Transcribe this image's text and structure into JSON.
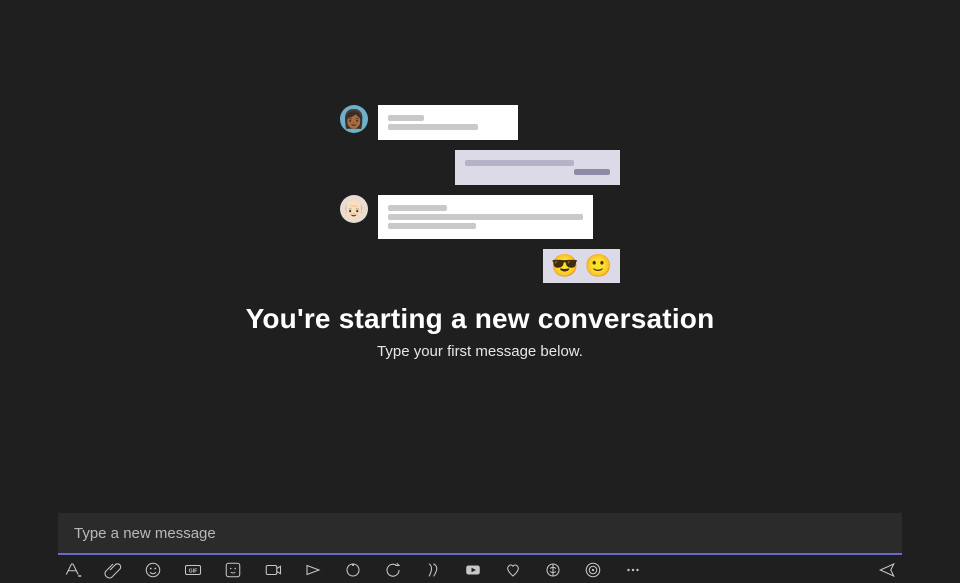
{
  "emptyState": {
    "title": "You're starting a new conversation",
    "subtitle": "Type your first message below.",
    "emoji1": "😎",
    "emoji2": "🙂"
  },
  "compose": {
    "placeholder": "Type a new message"
  },
  "toolbar": {
    "format": "Format",
    "attach": "Attach",
    "emoji": "Emoji",
    "gif": "GIF",
    "sticker": "Sticker",
    "schedule": "Schedule meeting",
    "stream": "Stream",
    "loop": "Loop components",
    "approvals": "Approvals",
    "apps1": "Viva",
    "video": "Video",
    "praise": "Praise",
    "app2": "App",
    "app3": "App",
    "more": "More",
    "send": "Send"
  }
}
